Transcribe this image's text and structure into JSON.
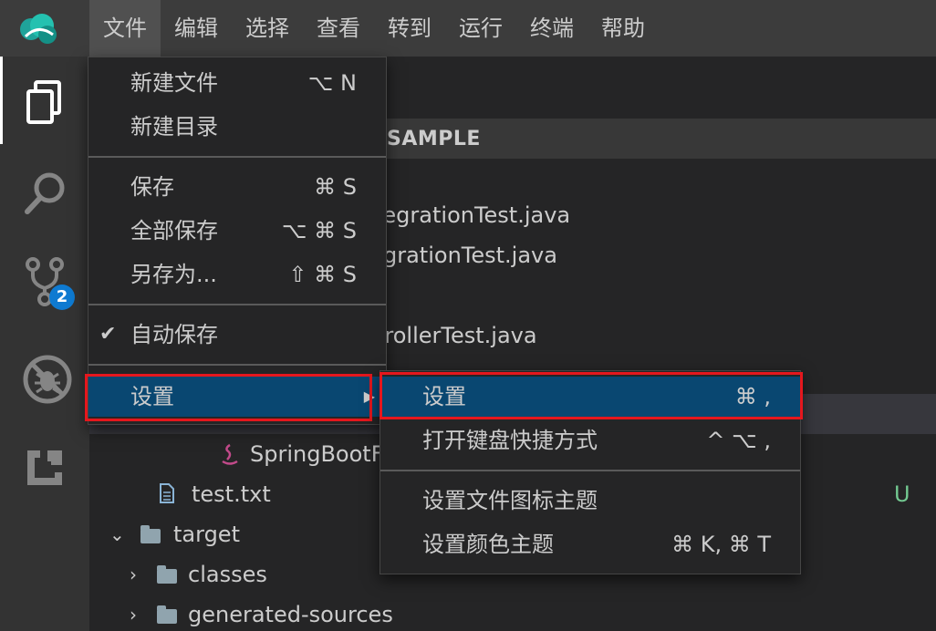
{
  "menubar": [
    "文件",
    "编辑",
    "选择",
    "查看",
    "转到",
    "运行",
    "终端",
    "帮助"
  ],
  "activity": {
    "scm_badge": "2"
  },
  "explorer": {
    "section_title": "SAMPLE",
    "rows": [
      "tegrationTest.java",
      "grationTest.java",
      "trollerTest.java",
      "SpringBootF",
      "test.txt",
      "target",
      "classes",
      "generated-sources"
    ],
    "untracked_marker": "U"
  },
  "file_menu": {
    "items": [
      {
        "label": "新建文件",
        "shortcut": "⌥ N"
      },
      {
        "label": "新建目录",
        "shortcut": ""
      },
      {
        "label": "保存",
        "shortcut": "⌘ S"
      },
      {
        "label": "全部保存",
        "shortcut": "⌥ ⌘ S"
      },
      {
        "label": "另存为...",
        "shortcut": "⇧ ⌘ S"
      },
      {
        "label": "自动保存",
        "shortcut": ""
      },
      {
        "label": "设置",
        "shortcut": ""
      }
    ],
    "checkmark": "✔",
    "submenu_arrow": "▶"
  },
  "settings_submenu": {
    "items": [
      {
        "label": "设置",
        "shortcut": "⌘ ,"
      },
      {
        "label": "打开键盘快捷方式",
        "shortcut": "^ ⌥ ,"
      },
      {
        "label": "设置文件图标主题",
        "shortcut": ""
      },
      {
        "label": "设置颜色主题",
        "shortcut": "⌘ K, ⌘ T"
      }
    ]
  },
  "colors": {
    "accent_selected": "#094771",
    "highlight_box": "#e5171d",
    "badge": "#0e7ad1",
    "untracked": "#73c991"
  }
}
